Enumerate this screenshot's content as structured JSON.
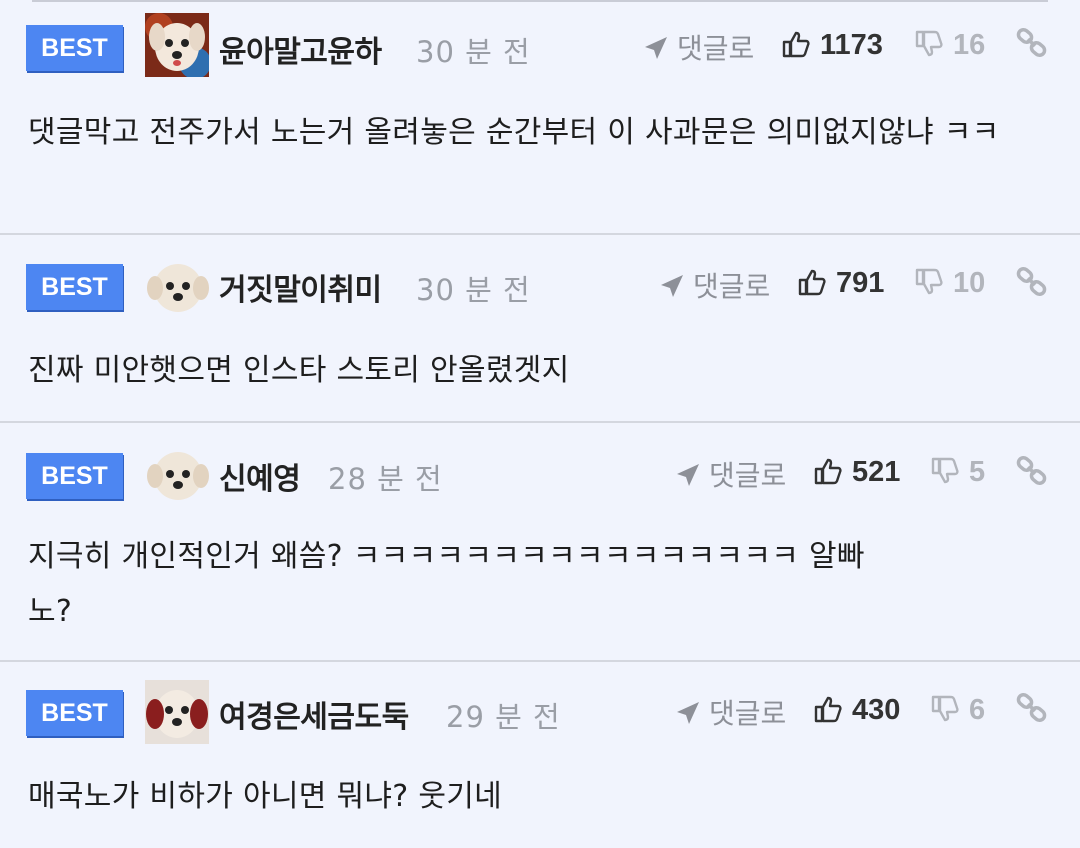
{
  "comments": [
    {
      "badge": "BEST",
      "username": "윤아말고윤하",
      "time": "30 분 전",
      "reply_label": "댓글로",
      "likes": "1173",
      "dislikes": "16",
      "text": "댓글막고 전주가서 노는거 올려놓은 순간부터 이 사과문은 의미없지않냐 ㅋㅋ"
    },
    {
      "badge": "BEST",
      "username": "거짓말이취미",
      "time": "30 분 전",
      "reply_label": "댓글로",
      "likes": "791",
      "dislikes": "10",
      "text": "진짜 미안햇으면 인스타 스토리 안올렸겟지"
    },
    {
      "badge": "BEST",
      "username": "신예영",
      "time": "28 분 전",
      "reply_label": "댓글로",
      "likes": "521",
      "dislikes": "5",
      "text": "지극히 개인적인거 왜씀? ㅋㅋㅋㅋㅋㅋㅋㅋㅋㅋㅋㅋㅋㅋㅋㅋ 알빠노?"
    },
    {
      "badge": "BEST",
      "username": "여경은세금도둑",
      "time": "29 분 전",
      "reply_label": "댓글로",
      "likes": "430",
      "dislikes": "6",
      "text": "매국노가 비하가 아니면 뭐냐? 웃기네"
    }
  ],
  "icons": {
    "reply": "reply-arrow-icon",
    "like": "thumbs-up-icon",
    "dislike": "thumbs-down-icon",
    "link": "link-icon"
  },
  "colors": {
    "background": "#f1f4fd",
    "best_badge": "#4d86f2",
    "muted_text": "#9a9ea6"
  }
}
